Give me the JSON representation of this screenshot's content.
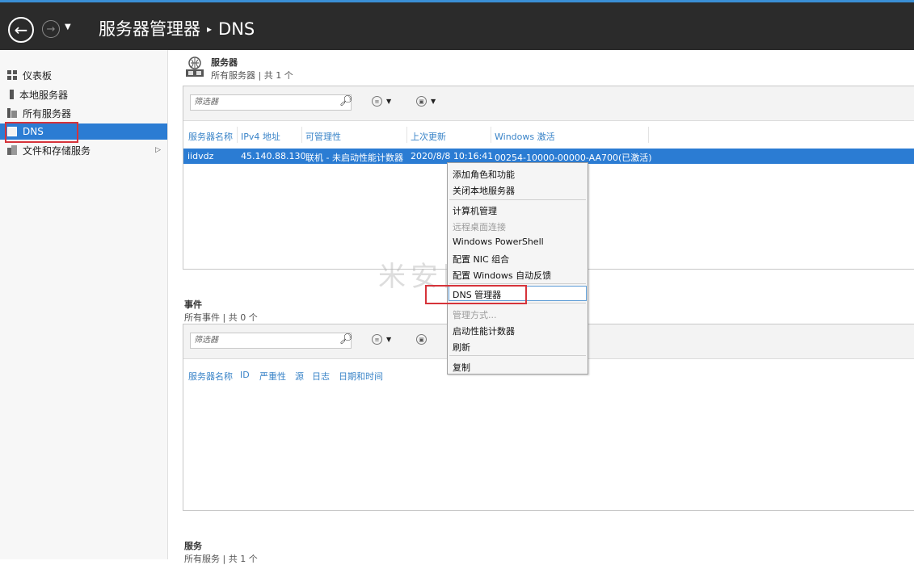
{
  "window": {
    "breadcrumb_root": "服务器管理器",
    "breadcrumb_sep": "▸",
    "breadcrumb_current": "DNS"
  },
  "nav": {
    "back_icon": "back-arrow-icon",
    "forward_icon": "forward-arrow-icon",
    "history_icon": "history-dropdown-icon"
  },
  "sidebar": {
    "items": [
      {
        "label": "仪表板",
        "icon": "dashboard-icon"
      },
      {
        "label": "本地服务器",
        "icon": "local-server-icon"
      },
      {
        "label": "所有服务器",
        "icon": "all-servers-icon"
      },
      {
        "label": "DNS",
        "icon": "dns-icon",
        "active": true
      },
      {
        "label": "文件和存储服务",
        "icon": "file-storage-icon",
        "has_submenu": true
      }
    ],
    "submenu_arrow": "▷"
  },
  "servers": {
    "title": "服务器",
    "subtitle": "所有服务器 | 共 1 个",
    "filter_placeholder": "筛选器",
    "columns": [
      "服务器名称",
      "IPv4 地址",
      "可管理性",
      "上次更新",
      "Windows 激活"
    ],
    "rows": [
      {
        "name": "iidvdz",
        "ipv4": "45.140.88.130",
        "manageability": "联机 - 未启动性能计数器",
        "last_update": "2020/8/8 10:16:41",
        "activation": "00254-10000-00000-AA700(已激活)",
        "selected": true
      }
    ]
  },
  "events": {
    "title": "事件",
    "subtitle": "所有事件 | 共 0 个",
    "filter_placeholder": "筛选器",
    "columns": [
      "服务器名称",
      "ID",
      "严重性",
      "源",
      "日志",
      "日期和时间"
    ]
  },
  "services": {
    "title": "服务",
    "subtitle": "所有服务 | 共 1 个"
  },
  "context_menu": {
    "items": [
      {
        "label": "添加角色和功能",
        "enabled": true
      },
      {
        "label": "关闭本地服务器",
        "enabled": true
      },
      {
        "label": "计算机管理",
        "enabled": true
      },
      {
        "label": "远程桌面连接",
        "enabled": false
      },
      {
        "label": "Windows PowerShell",
        "enabled": true
      },
      {
        "label": "配置 NIC 组合",
        "enabled": true
      },
      {
        "label": "配置 Windows 自动反馈",
        "enabled": true
      },
      {
        "label": "DNS 管理器",
        "enabled": true,
        "highlighted": true
      },
      {
        "label": "管理方式...",
        "enabled": false
      },
      {
        "label": "启动性能计数器",
        "enabled": true
      },
      {
        "label": "刷新",
        "enabled": true
      },
      {
        "label": "复制",
        "enabled": true
      }
    ]
  },
  "watermark": "米安网络",
  "colors": {
    "titlebar_bg": "#2b2b2b",
    "accent": "#2b7cd3",
    "header_link": "#3a84c8",
    "highlight_border": "#d6333a"
  }
}
